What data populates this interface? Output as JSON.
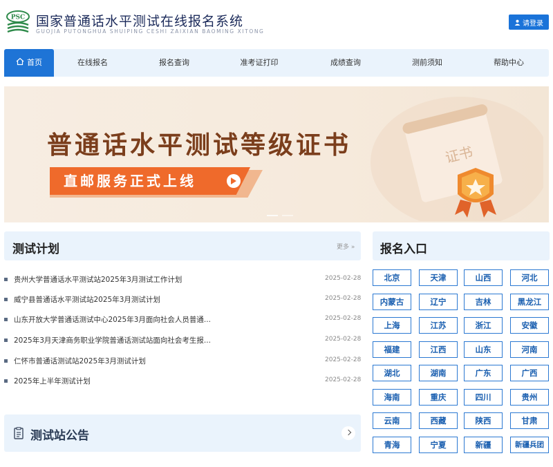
{
  "header": {
    "logo_text": "PSC",
    "title": "国家普通话水平测试在线报名系统",
    "pinyin": "GUOJIA PUTONGHUA SHUIPING CESHI ZAIXIAN BAOMING XITONG",
    "login_label": "请登录"
  },
  "nav": [
    {
      "label": "首页",
      "active": true
    },
    {
      "label": "在线报名"
    },
    {
      "label": "报名查询"
    },
    {
      "label": "准考证打印"
    },
    {
      "label": "成绩查询"
    },
    {
      "label": "测前须知"
    },
    {
      "label": "帮助中心"
    }
  ],
  "banner": {
    "title": "普通话水平测试等级证书",
    "subtitle": "直邮服务正式上线",
    "deco_text": "证书"
  },
  "test_plan": {
    "title": "测试计划",
    "more_label": "更多 »",
    "items": [
      {
        "text": "贵州大学普通话水平测试站2025年3月测试工作计划",
        "date": "2025-02-28"
      },
      {
        "text": "威宁县普通话水平测试站2025年3月测试计划",
        "date": "2025-02-28"
      },
      {
        "text": "山东开放大学普通话测试中心2025年3月面向社会人员普通...",
        "date": "2025-02-28"
      },
      {
        "text": "2025年3月天津商务职业学院普通话测试站面向社会考生报...",
        "date": "2025-02-28"
      },
      {
        "text": "仁怀市普通话测试站2025年3月测试计划",
        "date": "2025-02-28"
      },
      {
        "text": "2025年上半年测试计划",
        "date": "2025-02-28"
      }
    ]
  },
  "notice": {
    "title": "测试站公告"
  },
  "registration": {
    "title": "报名入口",
    "provinces": [
      "北京",
      "天津",
      "山西",
      "河北",
      "内蒙古",
      "辽宁",
      "吉林",
      "黑龙江",
      "上海",
      "江苏",
      "浙江",
      "安徽",
      "福建",
      "江西",
      "山东",
      "河南",
      "湖北",
      "湖南",
      "广东",
      "广西",
      "海南",
      "重庆",
      "四川",
      "贵州",
      "云南",
      "西藏",
      "陕西",
      "甘肃",
      "青海",
      "宁夏",
      "新疆",
      "新疆兵团"
    ]
  },
  "colors": {
    "primary": "#1e74d6",
    "nav_bg": "#eaf3fc",
    "banner_brown": "#7b3e1c",
    "banner_orange": "#ef6a2b"
  }
}
